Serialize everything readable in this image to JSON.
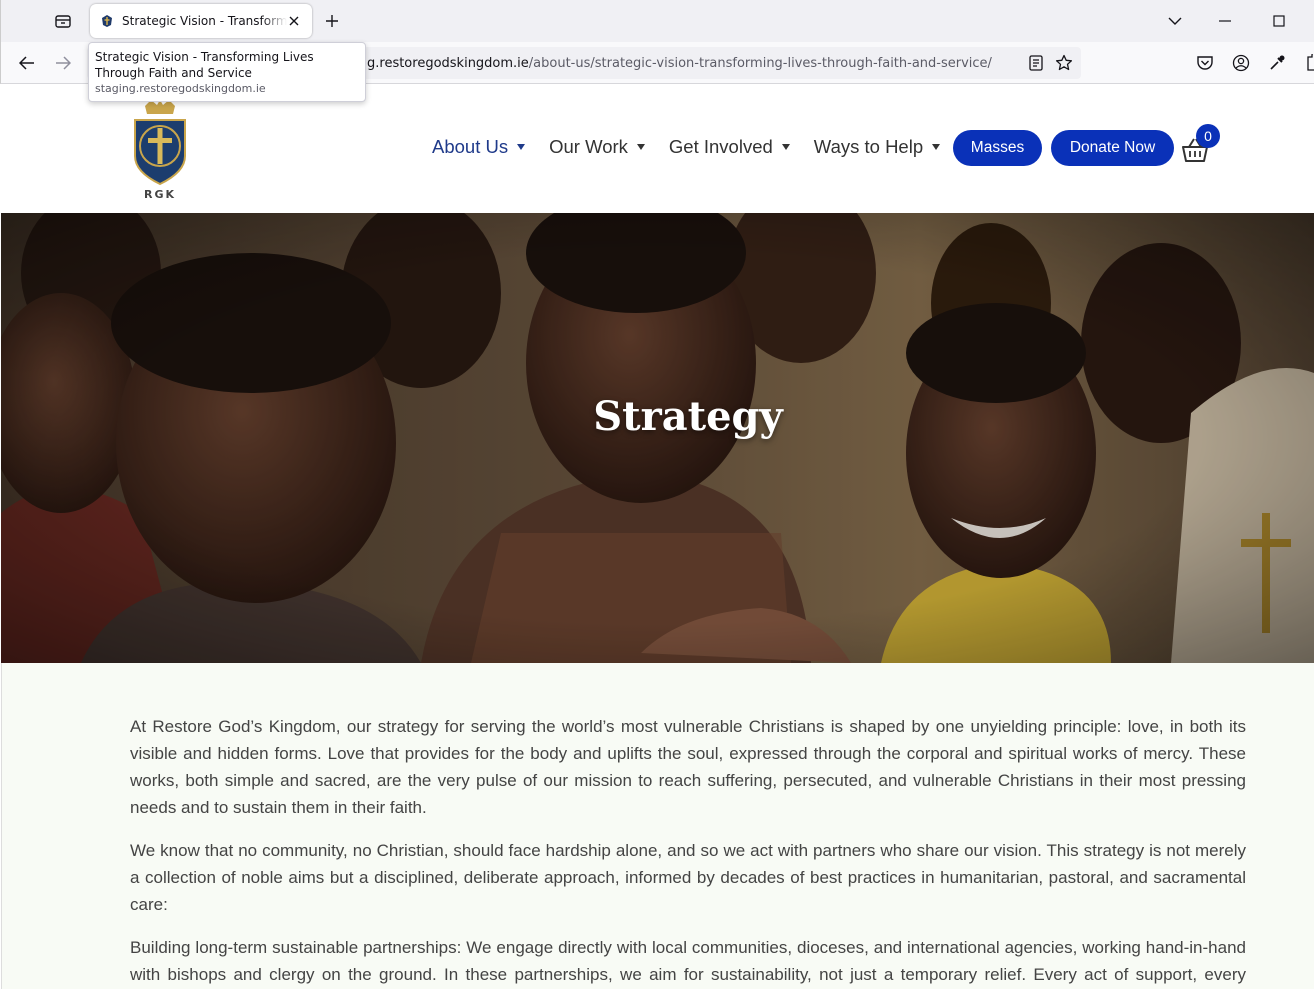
{
  "browser": {
    "tab_title": "Strategic Vision - Transforming Lives Through Faith and Service",
    "tooltip_title": "Strategic Vision - Transforming Lives Through Faith and Service",
    "tooltip_host": "staging.restoregodskingdom.ie",
    "url_host_visible": "g.restoregodskingdom.ie",
    "url_path": "/about-us/strategic-vision-transforming-lives-through-faith-and-service/",
    "icons": [
      "tab-list-icon",
      "favicon-icon",
      "close-tab-icon",
      "new-tab-icon",
      "tabs-overflow-icon",
      "minimize-icon",
      "maximize-icon",
      "back-icon",
      "forward-icon",
      "reader-view-icon",
      "bookmark-star-icon",
      "pocket-icon",
      "account-icon",
      "eyedropper-icon",
      "extensions-icon"
    ]
  },
  "header": {
    "logo_text": "RGK",
    "menu": [
      {
        "label": "About Us",
        "active": true
      },
      {
        "label": "Our Work",
        "active": false
      },
      {
        "label": "Get Involved",
        "active": false
      },
      {
        "label": "Ways to Help",
        "active": false
      }
    ],
    "masses_label": "Masses",
    "donate_label": "Donate Now",
    "cart_count": "0",
    "accent_color": "#0a31b8",
    "active_color": "#1f3a8a"
  },
  "hero": {
    "title": "Strategy"
  },
  "content": {
    "paragraphs": [
      "At Restore God’s Kingdom, our strategy for serving the world’s most vulnerable Christians is shaped by one unyielding principle: love, in both its visible and hidden forms. Love that provides for the body and uplifts the soul, expressed through the corporal and spiritual works of mercy. These works, both simple and sacred, are the very pulse of our mission to reach suffering, persecuted, and vulnerable Christians in their most pressing needs and to sustain them in their faith.",
      "We know that no community, no Christian, should face hardship alone, and so we act with partners who share our vision. This strategy is not merely a collection of noble aims but a disciplined, deliberate approach, informed by decades of best practices in humanitarian, pastoral, and sacramental care:",
      "Building long-term sustainable partnerships: We engage directly with local communities, dioceses, and international agencies, working hand-in-hand with bishops and clergy on the ground. In these partnerships, we aim for sustainability, not just a temporary relief. Every act of support, every gesture"
    ]
  }
}
